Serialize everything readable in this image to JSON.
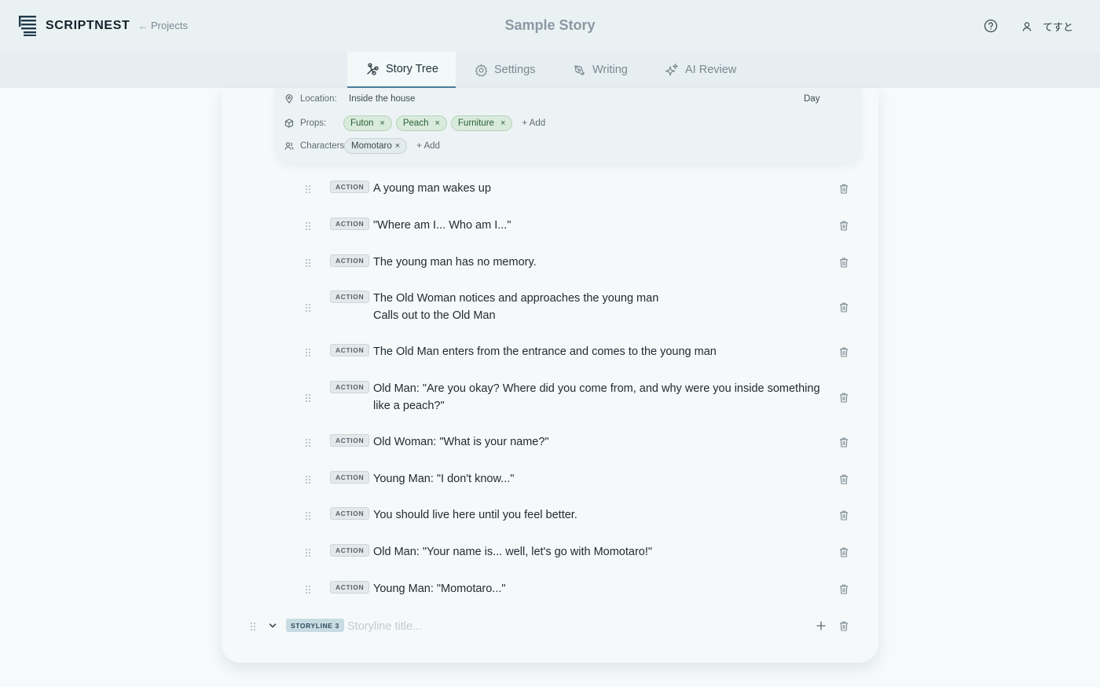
{
  "app": {
    "name": "SCRIPTNEST",
    "back_label": "Projects",
    "doc_title": "Sample Story",
    "user_name": "てすと"
  },
  "tabs": [
    {
      "label": "Story Tree",
      "icon": "tree-icon",
      "active": true
    },
    {
      "label": "Settings",
      "icon": "gear-icon",
      "active": false
    },
    {
      "label": "Writing",
      "icon": "pen-icon",
      "active": false
    },
    {
      "label": "AI Review",
      "icon": "sparkles-icon",
      "active": false
    }
  ],
  "scene": {
    "location_label": "Location:",
    "location": "Inside the house",
    "time_of_day": "Day",
    "props_label": "Props:",
    "props": [
      "Futon",
      "Peach",
      "Furniture"
    ],
    "characters_label": "Characters:",
    "characters": [
      "Momotaro"
    ],
    "add_label": "+ Add",
    "remove_glyph": "×"
  },
  "beats": [
    {
      "type": "ACTION",
      "text": "A young man wakes up"
    },
    {
      "type": "ACTION",
      "text": "\"Where am I... Who am I...\""
    },
    {
      "type": "ACTION",
      "text": "The young man has no memory."
    },
    {
      "type": "ACTION",
      "text": "The Old Woman notices and approaches the young man\nCalls out to the Old Man"
    },
    {
      "type": "ACTION",
      "text": "The Old Man enters from the entrance and comes to the young man"
    },
    {
      "type": "ACTION",
      "text": "Old Man: \"Are you okay? Where did you come from, and why were you inside something like a peach?\""
    },
    {
      "type": "ACTION",
      "text": "Old Woman: \"What is your name?\""
    },
    {
      "type": "ACTION",
      "text": "Young Man: \"I don't know...\""
    },
    {
      "type": "ACTION",
      "text": "You should live here until you feel better."
    },
    {
      "type": "ACTION",
      "text": "Old Man: \"Your name is... well, let's go with Momotaro!\""
    },
    {
      "type": "ACTION",
      "text": "Young Man: \"Momotaro...\""
    }
  ],
  "storyline": {
    "badge": "STORYLINE 3",
    "placeholder": "Storyline title...",
    "value": ""
  },
  "colors": {
    "accent": "#4c7f98",
    "prop_chip": "#d9ebdc",
    "header_bg": "#eaf1f3"
  }
}
